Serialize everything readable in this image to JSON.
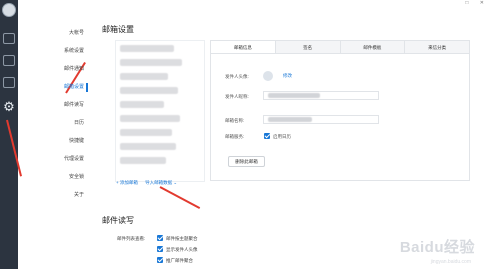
{
  "rail": {
    "icons": [
      "avatar-icon",
      "mail-icon",
      "contacts-icon",
      "calendar-icon",
      "gear-icon"
    ],
    "gear_glyph": "⚙"
  },
  "window": {
    "controls": "□ ✕"
  },
  "settings_nav": {
    "items": [
      {
        "label": "大帐号",
        "active": false
      },
      {
        "label": "系统设置",
        "active": false
      },
      {
        "label": "邮件通知",
        "active": false
      },
      {
        "label": "邮箱设置",
        "active": true
      },
      {
        "label": "邮件读写",
        "active": false
      },
      {
        "label": "日历",
        "active": false
      },
      {
        "label": "快捷键",
        "active": false
      },
      {
        "label": "代理设置",
        "active": false
      },
      {
        "label": "安全锁",
        "active": false
      },
      {
        "label": "关于",
        "active": false
      }
    ]
  },
  "mailbox_settings": {
    "title": "邮箱设置",
    "add_mailbox": "+ 添加邮箱",
    "import_data": "导入邮箱数据 ⌄",
    "tabs": [
      {
        "label": "邮箱信息",
        "active": true
      },
      {
        "label": "签名",
        "active": false
      },
      {
        "label": "邮件模板",
        "active": false
      },
      {
        "label": "来信分类",
        "active": false
      }
    ],
    "sender_avatar_label": "发件人头像:",
    "edit_link": "修改",
    "sender_nickname_label": "发件人昵称:",
    "mailbox_name_label": "邮箱名称:",
    "mailbox_service_label": "邮箱服务:",
    "enable_calendar_label": "启用日历",
    "delete_button": "删除此邮箱"
  },
  "mail_read_write": {
    "title": "邮件读写",
    "list_view_label": "邮件列表查看:",
    "options": [
      {
        "label": "邮件按主题聚合",
        "checked": true
      },
      {
        "label": "显示发件人头像",
        "checked": true
      },
      {
        "label": "推广邮件聚合",
        "checked": true
      }
    ]
  },
  "watermark": {
    "brand": "Baidu经验",
    "sub": "jingyan.baidu.com"
  },
  "colors": {
    "accent": "#1877d6",
    "rail": "#2c3440",
    "annotation": "#e23a2f"
  }
}
